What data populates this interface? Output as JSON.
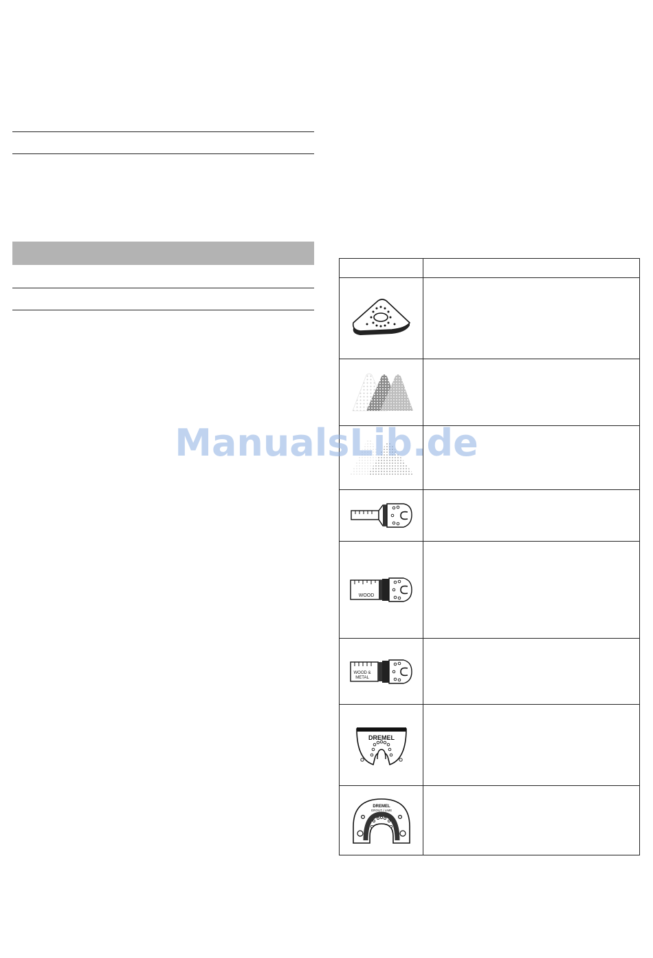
{
  "watermark": "ManualsLib.de",
  "table": {
    "header_col1": "",
    "header_col2": "",
    "rows": [
      {
        "icon": "triangle-sanding-pad-icon",
        "desc": ""
      },
      {
        "icon": "sanding-sheets-icon",
        "desc": ""
      },
      {
        "icon": "abrasive-sheets-icon",
        "desc": ""
      },
      {
        "icon": "narrow-plunge-blade-icon",
        "desc": ""
      },
      {
        "icon": "wood-plunge-blade-icon",
        "desc": ""
      },
      {
        "icon": "wood-metal-plunge-blade-icon",
        "desc": ""
      },
      {
        "icon": "dremel-segment-saw-blade-icon",
        "desc": ""
      },
      {
        "icon": "dremel-grout-blade-icon",
        "desc": ""
      }
    ],
    "blade_labels": {
      "wood": "WOOD",
      "wood_metal_1": "WOOD &",
      "wood_metal_2": "METAL",
      "dremel": "DREMEL",
      "grout": "GROUT / LIME"
    }
  }
}
